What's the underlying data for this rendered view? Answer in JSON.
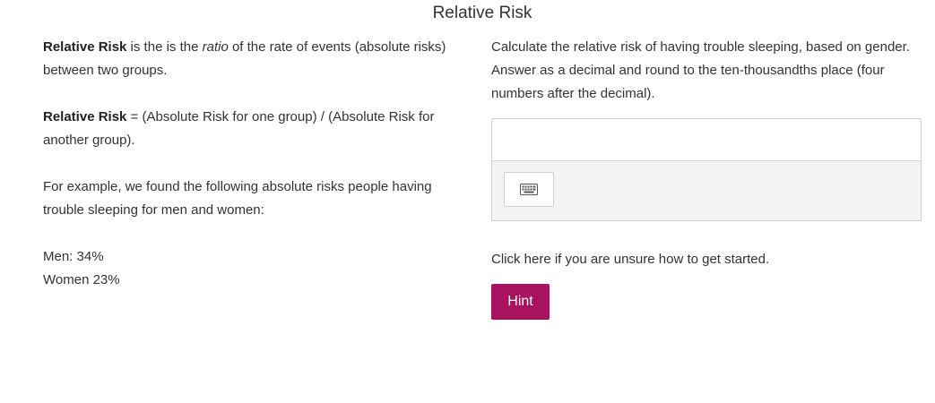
{
  "page": {
    "title": "Relative Risk"
  },
  "left": {
    "definition_term": "Relative Risk",
    "definition_pre": " is the is the ",
    "definition_italic": "ratio",
    "definition_post": " of the rate of events (absolute risks) between two groups.",
    "formula_term": "Relative Risk",
    "formula_text": " = (Absolute Risk for one group) / (Absolute Risk for another group).",
    "example_text": "For example, we found the following absolute risks people having trouble sleeping for men and women:",
    "stats": [
      "Men: 34%",
      "Women 23%"
    ]
  },
  "right": {
    "question": "Calculate the relative risk of having trouble sleeping, based on gender. Answer as a decimal and round to the ten-thousandths place (four numbers after the decimal).",
    "answer_value": "",
    "keyboard_icon": "keyboard-icon",
    "help_text": "Click here if you are unsure how to get started.",
    "hint_label": "Hint",
    "accent_color": "#a8125e"
  }
}
